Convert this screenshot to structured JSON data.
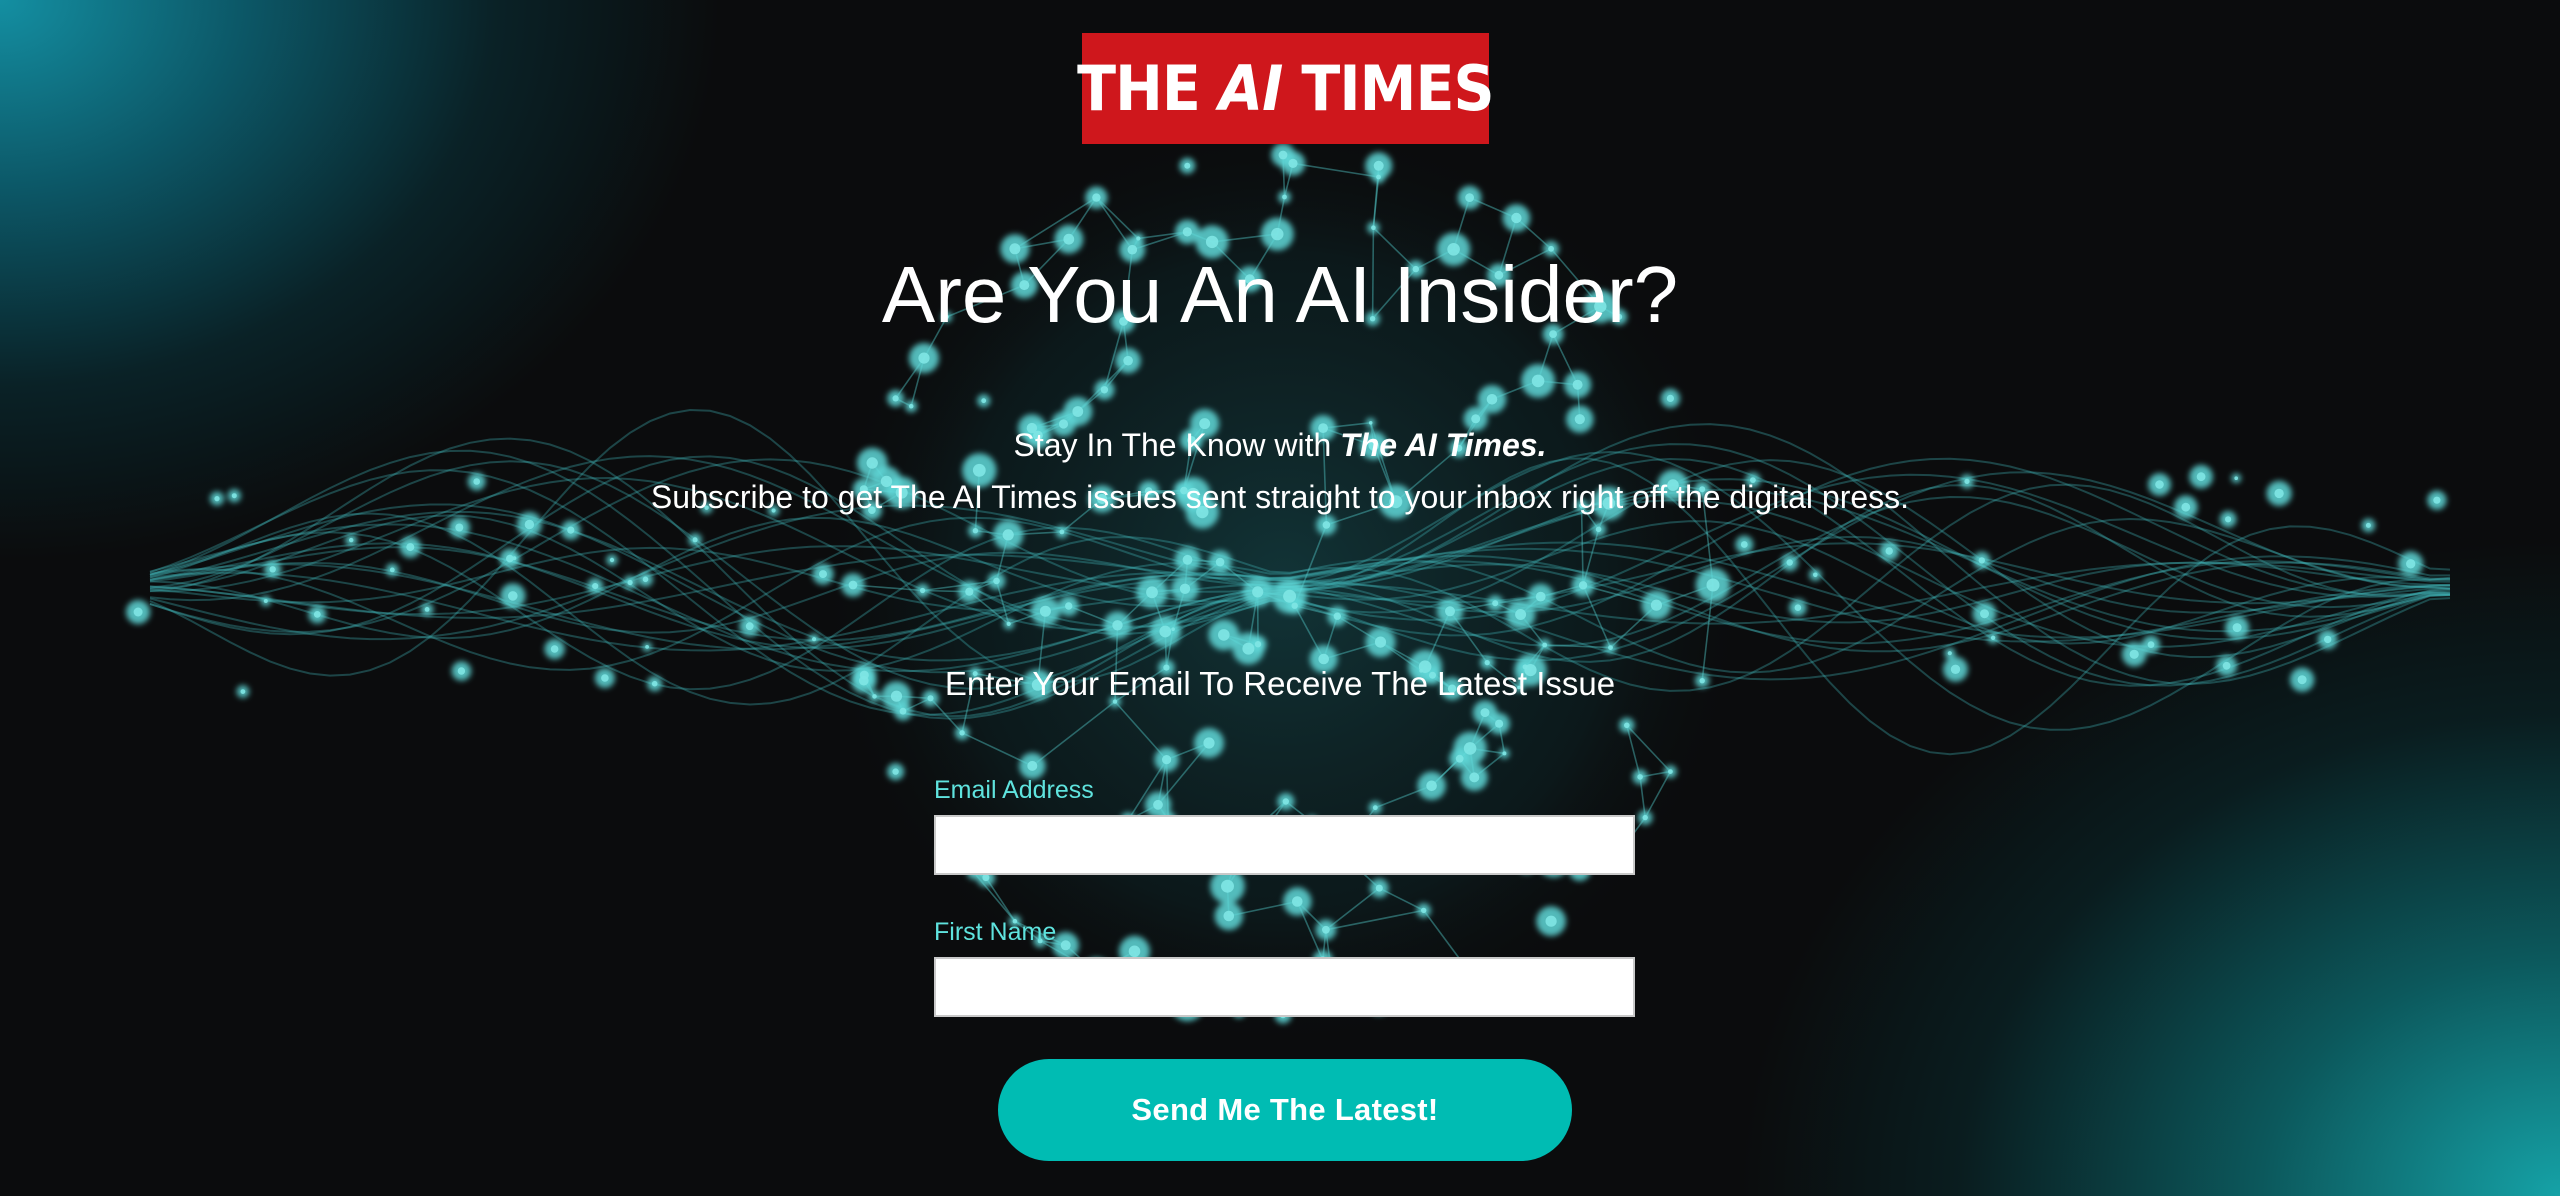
{
  "logo": {
    "text_before": "THE ",
    "text_ai": "AI",
    "text_after": " TIMES"
  },
  "headline": "Are You An AI Insider?",
  "tagline": {
    "prefix": "Stay In The Know with ",
    "emphasis": "The AI Times."
  },
  "subtext": "Subscribe to get The AI Times issues sent straight to your inbox right off the digital press.",
  "form": {
    "prompt": "Enter Your Email To Receive The Latest Issue",
    "email": {
      "label": "Email Address",
      "value": ""
    },
    "first_name": {
      "label": "First Name",
      "value": ""
    },
    "submit_label": "Send Me The Latest!"
  },
  "colors": {
    "background": "#0b0c0d",
    "logo_red": "#cf171c",
    "accent_teal": "#00bcb3",
    "label_teal": "#5fe3de"
  }
}
